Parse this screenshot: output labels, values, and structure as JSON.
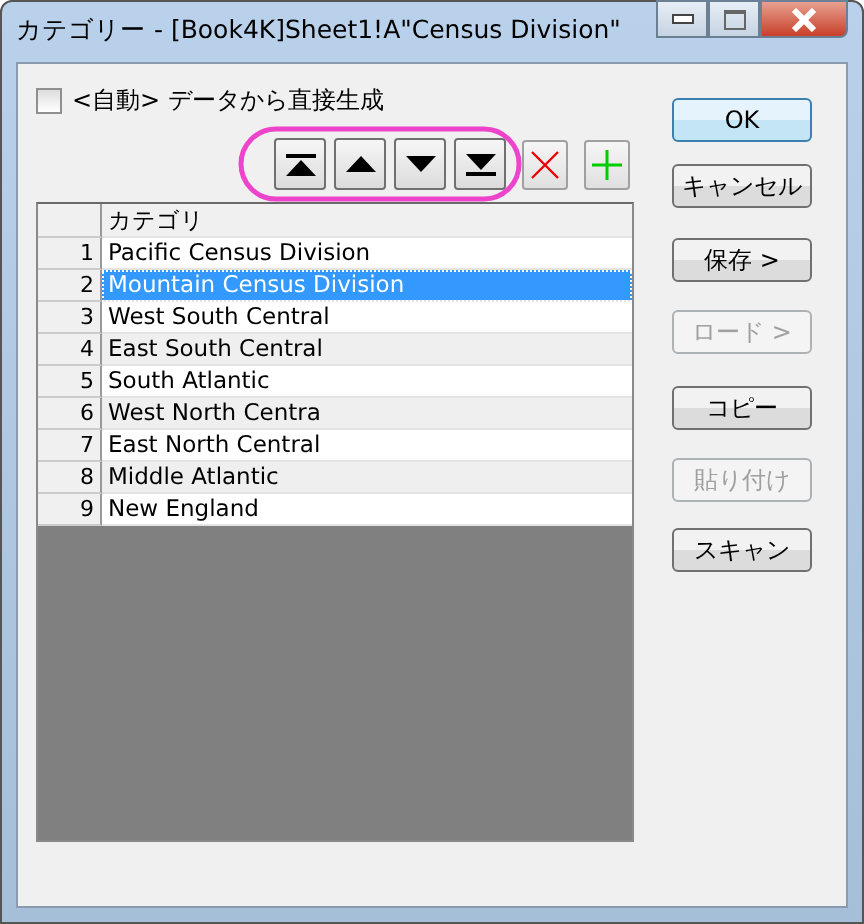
{
  "window": {
    "title": "カテゴリー - [Book4K]Sheet1!A\"Census Division\""
  },
  "auto_checkbox": {
    "label": "<自動> データから直接生成",
    "checked": false
  },
  "move_buttons": [
    {
      "kind": "top"
    },
    {
      "kind": "up"
    },
    {
      "kind": "down"
    },
    {
      "kind": "bottom"
    }
  ],
  "table": {
    "columns": [
      "カテゴリ"
    ],
    "rows": [
      {
        "number": "1",
        "value": "Pacific Census Division",
        "selected": false
      },
      {
        "number": "2",
        "value": "Mountain Census Division",
        "selected": true
      },
      {
        "number": "3",
        "value": "West South Central",
        "selected": false
      },
      {
        "number": "4",
        "value": "East South Central",
        "selected": false
      },
      {
        "number": "5",
        "value": "South Atlantic",
        "selected": false
      },
      {
        "number": "6",
        "value": "West North Centra",
        "selected": false
      },
      {
        "number": "7",
        "value": "East North Central",
        "selected": false
      },
      {
        "number": "8",
        "value": "Middle Atlantic",
        "selected": false
      },
      {
        "number": "9",
        "value": "New England",
        "selected": false
      }
    ]
  },
  "buttons": [
    {
      "label": "OK",
      "disabled": false,
      "default": true
    },
    {
      "label": "キャンセル",
      "disabled": false,
      "default": false
    },
    {
      "label": "保存 >",
      "disabled": false,
      "default": false
    },
    {
      "label": "ロード >",
      "disabled": true,
      "default": false
    },
    {
      "label": "コピー",
      "disabled": false,
      "default": false
    },
    {
      "label": "貼り付け",
      "disabled": true,
      "default": false
    },
    {
      "label": "スキャン",
      "disabled": false,
      "default": false
    }
  ]
}
